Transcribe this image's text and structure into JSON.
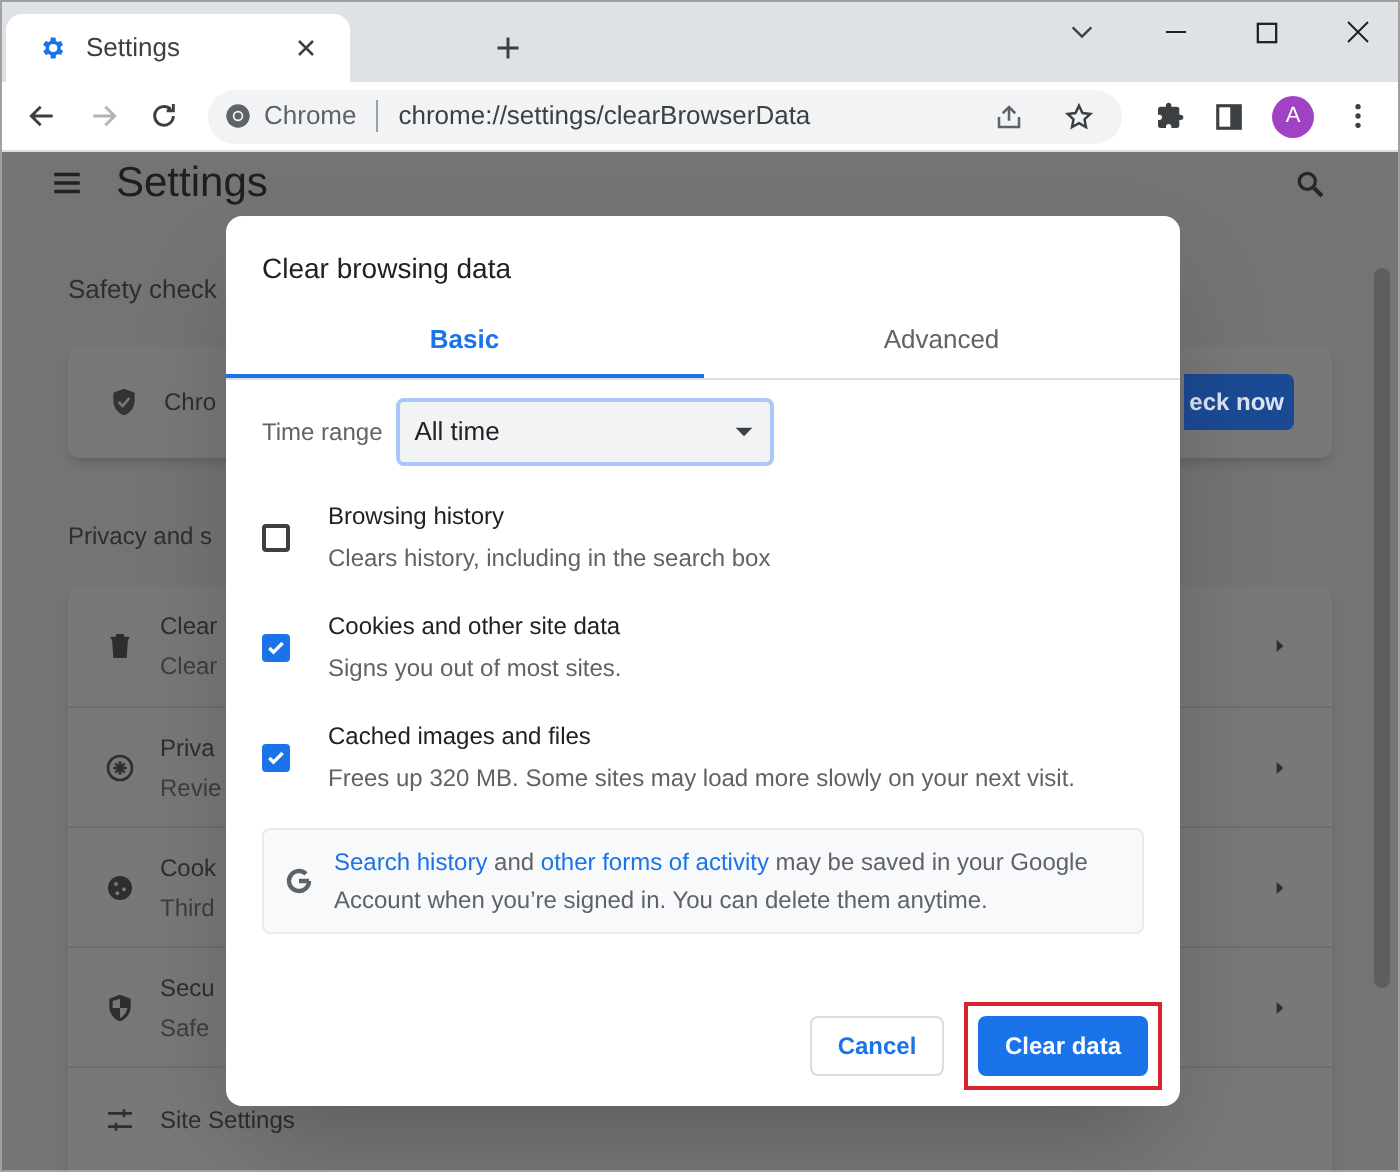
{
  "browser": {
    "tab": {
      "title": "Settings",
      "selected": true
    },
    "omnibox": {
      "site_label": "Chrome",
      "url": "chrome://settings/clearBrowserData"
    },
    "avatar": "A"
  },
  "settings_page": {
    "title": "Settings",
    "safety_check": {
      "heading": "Safety check",
      "item_text": "Chro",
      "button": "eck now"
    },
    "privacy": {
      "heading": "Privacy and s",
      "rows": [
        {
          "title": "Clear",
          "subtitle": "Clear"
        },
        {
          "title": "Priva",
          "subtitle": "Revie"
        },
        {
          "title": "Cook",
          "subtitle": "Third"
        },
        {
          "title": "Secu",
          "subtitle": "Safe"
        },
        {
          "title": "Site Settings"
        }
      ]
    }
  },
  "dialog": {
    "title": "Clear browsing data",
    "tabs": [
      {
        "label": "Basic",
        "selected": true
      },
      {
        "label": "Advanced",
        "selected": false
      }
    ],
    "time_range": {
      "label": "Time range",
      "value": "All time"
    },
    "options": [
      {
        "title": "Browsing history",
        "description": "Clears history, including in the search box",
        "checked": false
      },
      {
        "title": "Cookies and other site data",
        "description": "Signs you out of most sites.",
        "checked": true
      },
      {
        "title": "Cached images and files",
        "description": "Frees up 320 MB. Some sites may load more slowly on your next visit.",
        "checked": true
      }
    ],
    "info": [
      {
        "kind": "link",
        "text": "Search history"
      },
      {
        "kind": "text",
        "text": " and "
      },
      {
        "kind": "link",
        "text": "other forms of activity"
      },
      {
        "kind": "text",
        "text": " may be saved in your Google Account when you’re signed in. You can delete them anytime."
      }
    ],
    "buttons": [
      {
        "label": "Cancel",
        "kind": "secondary"
      },
      {
        "label": "Clear data",
        "kind": "primary",
        "highlighted": true
      }
    ]
  }
}
